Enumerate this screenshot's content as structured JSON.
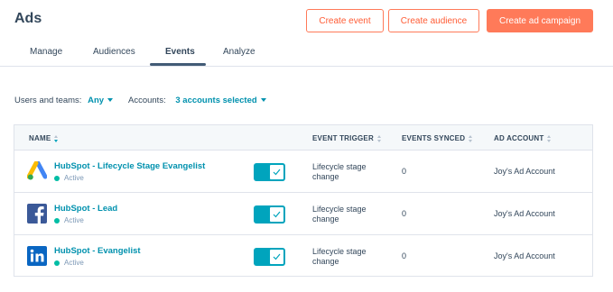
{
  "header": {
    "title": "Ads",
    "buttons": {
      "create_event": "Create event",
      "create_audience": "Create audience",
      "create_campaign": "Create ad campaign"
    }
  },
  "tabs": [
    {
      "label": "Manage"
    },
    {
      "label": "Audiences"
    },
    {
      "label": "Events",
      "active": true
    },
    {
      "label": "Analyze"
    }
  ],
  "filters": {
    "users_label": "Users and teams:",
    "users_value": "Any",
    "accounts_label": "Accounts:",
    "accounts_value": "3 accounts selected"
  },
  "table": {
    "columns": {
      "name": "NAME",
      "trigger": "EVENT TRIGGER",
      "synced": "EVENTS SYNCED",
      "account": "AD ACCOUNT"
    },
    "rows": [
      {
        "network": "google-ads-icon",
        "name": "HubSpot - Lifecycle Stage Evangelist",
        "status": "Active",
        "enabled": true,
        "trigger": "Lifecycle stage change",
        "synced": "0",
        "account": "Joy's Ad Account"
      },
      {
        "network": "facebook-icon",
        "name": "HubSpot - Lead",
        "status": "Active",
        "enabled": true,
        "trigger": "Lifecycle stage change",
        "synced": "0",
        "account": "Joy's Ad Account"
      },
      {
        "network": "linkedin-icon",
        "name": "HubSpot - Evangelist",
        "status": "Active",
        "enabled": true,
        "trigger": "Lifecycle stage change",
        "synced": "0",
        "account": "Joy's Ad Account"
      }
    ]
  },
  "colors": {
    "accent": "#ff7a59",
    "link": "#0091ae",
    "toggle": "#00a4bd",
    "active_dot": "#00bda5"
  }
}
